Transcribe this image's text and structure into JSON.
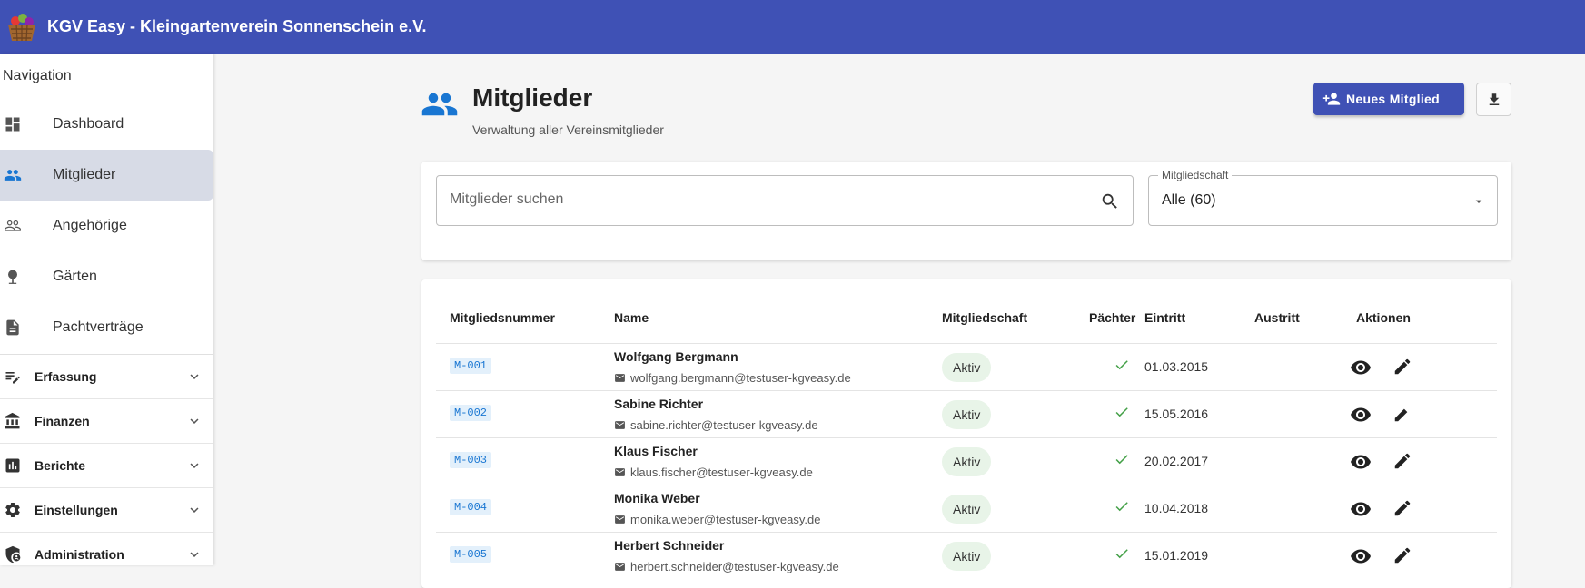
{
  "app": {
    "title": "KGV Easy - Kleingartenverein Sonnenschein e.V."
  },
  "sidebar": {
    "header": "Navigation",
    "items": [
      {
        "label": "Dashboard",
        "icon": "dashboard-icon",
        "active": false
      },
      {
        "label": "Mitglieder",
        "icon": "people-icon",
        "active": true
      },
      {
        "label": "Angehörige",
        "icon": "people-outline-icon",
        "active": false
      },
      {
        "label": "Gärten",
        "icon": "tree-icon",
        "active": false
      },
      {
        "label": "Pachtverträge",
        "icon": "document-icon",
        "active": false
      }
    ],
    "groups": [
      {
        "label": "Erfassung",
        "icon": "edit-note-icon"
      },
      {
        "label": "Finanzen",
        "icon": "bank-icon"
      },
      {
        "label": "Berichte",
        "icon": "bar-chart-icon"
      },
      {
        "label": "Einstellungen",
        "icon": "gear-icon"
      },
      {
        "label": "Administration",
        "icon": "admin-shield-icon"
      }
    ]
  },
  "page": {
    "title": "Mitglieder",
    "subtitle": "Verwaltung aller Vereinsmitglieder",
    "new_button": "Neues Mitglied"
  },
  "filter": {
    "search_placeholder": "Mitglieder suchen",
    "membership_label": "Mitgliedschaft",
    "membership_value": "Alle (60)"
  },
  "table": {
    "headers": [
      "Mitgliedsnummer",
      "Name",
      "Mitgliedschaft",
      "Pächter",
      "Eintritt",
      "Austritt",
      "Aktionen"
    ],
    "rows": [
      {
        "id": "M-001",
        "name": "Wolfgang Bergmann",
        "email": "wolfgang.bergmann@testuser-kgveasy.de",
        "status": "Aktiv",
        "tenant": true,
        "entry": "01.03.2015",
        "exit": ""
      },
      {
        "id": "M-002",
        "name": "Sabine Richter",
        "email": "sabine.richter@testuser-kgveasy.de",
        "status": "Aktiv",
        "tenant": true,
        "entry": "15.05.2016",
        "exit": ""
      },
      {
        "id": "M-003",
        "name": "Klaus Fischer",
        "email": "klaus.fischer@testuser-kgveasy.de",
        "status": "Aktiv",
        "tenant": true,
        "entry": "20.02.2017",
        "exit": ""
      },
      {
        "id": "M-004",
        "name": "Monika Weber",
        "email": "monika.weber@testuser-kgveasy.de",
        "status": "Aktiv",
        "tenant": true,
        "entry": "10.04.2018",
        "exit": ""
      },
      {
        "id": "M-005",
        "name": "Herbert Schneider",
        "email": "herbert.schneider@testuser-kgveasy.de",
        "status": "Aktiv",
        "tenant": true,
        "entry": "15.01.2019",
        "exit": ""
      }
    ]
  },
  "colors": {
    "primary": "#3f51b5",
    "accent_blue": "#1976d2",
    "check_green": "#43a047",
    "status_bg": "#e8f4e8"
  }
}
